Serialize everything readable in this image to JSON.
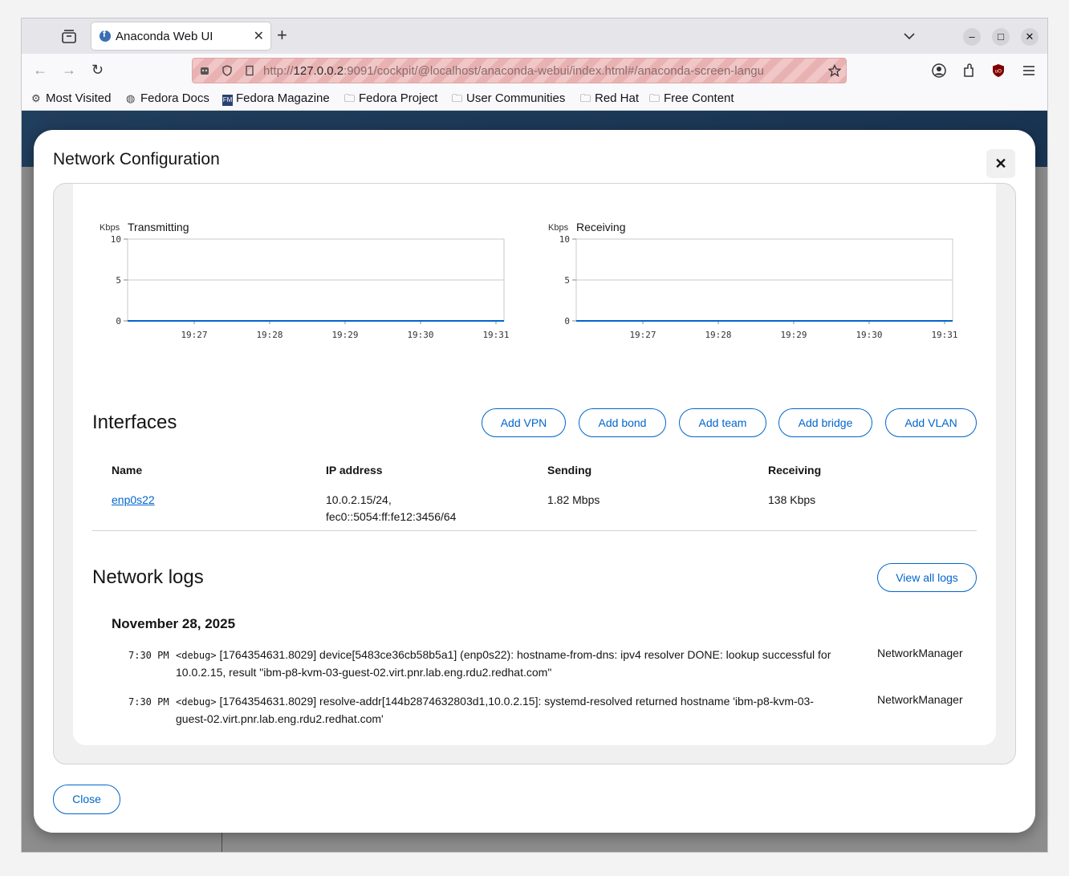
{
  "browser": {
    "tab_title": "Anaconda Web UI",
    "url_host": "127.0.0.2",
    "url_rest": ":9091/cockpit/@localhost/anaconda-webui/index.html#/anaconda-screen-langu",
    "url_prefix": "http://",
    "bookmarks": [
      {
        "label": "Most Visited",
        "icon": "gear-icon"
      },
      {
        "label": "Fedora Docs",
        "icon": "globe-icon"
      },
      {
        "label": "Fedora Magazine",
        "icon": "fm-icon"
      },
      {
        "label": "Fedora Project",
        "icon": "folder-icon"
      },
      {
        "label": "User Communities",
        "icon": "folder-icon"
      },
      {
        "label": "Red Hat",
        "icon": "folder-icon"
      },
      {
        "label": "Free Content",
        "icon": "folder-icon"
      }
    ]
  },
  "modal": {
    "title": "Network Configuration",
    "close_label": "Close"
  },
  "charts": {
    "transmit": {
      "unit": "Kbps",
      "title": "Transmitting"
    },
    "receive": {
      "unit": "Kbps",
      "title": "Receiving"
    }
  },
  "chart_data": [
    {
      "type": "line",
      "title": "Transmitting",
      "ylabel": "Kbps",
      "ylim": [
        0,
        10
      ],
      "yticks": [
        "0",
        "5",
        "10"
      ],
      "xticks": [
        "19:27",
        "19:28",
        "19:29",
        "19:30",
        "19:31"
      ],
      "series": [
        {
          "values": [
            0,
            0,
            0,
            0,
            0,
            0
          ]
        }
      ],
      "grid": true
    },
    {
      "type": "line",
      "title": "Receiving",
      "ylabel": "Kbps",
      "ylim": [
        0,
        10
      ],
      "yticks": [
        "0",
        "5",
        "10"
      ],
      "xticks": [
        "19:27",
        "19:28",
        "19:29",
        "19:30",
        "19:31"
      ],
      "series": [
        {
          "values": [
            0,
            0,
            0,
            0,
            0,
            0
          ]
        }
      ],
      "grid": true
    }
  ],
  "interfaces": {
    "heading": "Interfaces",
    "buttons": [
      "Add VPN",
      "Add bond",
      "Add team",
      "Add bridge",
      "Add VLAN"
    ],
    "columns": [
      "Name",
      "IP address",
      "Sending",
      "Receiving"
    ],
    "rows": [
      {
        "name": "enp0s22",
        "ip_line1": "10.0.2.15/24,",
        "ip_line2": "fec0::5054:ff:fe12:3456/64",
        "sending": "1.82 Mbps",
        "receiving": "138 Kbps"
      }
    ]
  },
  "logs": {
    "heading": "Network logs",
    "view_all": "View all logs",
    "date": "November 28, 2025",
    "entries": [
      {
        "time": "7:30 PM",
        "tag": "<debug>",
        "line1": "[1764354631.8029] device[5483ce36cb58b5a1] (enp0s22): hostname-from-dns: ipv4 resolver DONE: lookup successful for",
        "line2": "10.0.2.15, result \"ibm-p8-kvm-03-guest-02.virt.pnr.lab.eng.rdu2.redhat.com\"",
        "source": "NetworkManager"
      },
      {
        "time": "7:30 PM",
        "tag": "<debug>",
        "line1": "[1764354631.8029] resolve-addr[144b2874632803d1,10.0.2.15]: systemd-resolved returned hostname 'ibm-p8-kvm-03-",
        "line2": "guest-02.virt.pnr.lab.eng.rdu2.redhat.com'",
        "source": "NetworkManager"
      }
    ]
  }
}
